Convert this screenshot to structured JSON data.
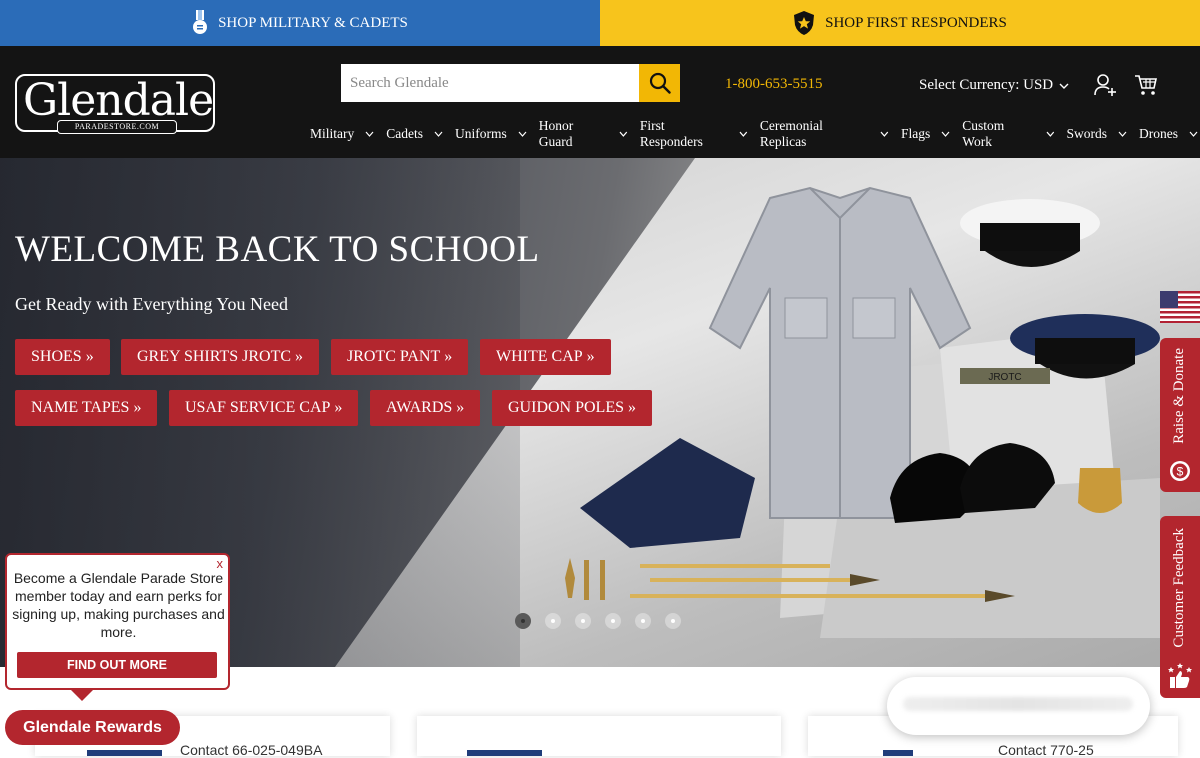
{
  "topbar": {
    "military_label": "SHOP MILITARY & CADETS",
    "military_icon": "medal-icon",
    "responders_label": "SHOP FIRST RESPONDERS",
    "responders_icon": "badge-star-icon"
  },
  "header": {
    "logo_word": "Glendale",
    "logo_sub": "PARADESTORE.COM",
    "search_placeholder": "Search Glendale",
    "phone": "1-800-653-5515",
    "currency_label": "Select Currency: USD"
  },
  "nav": [
    {
      "label": "Military"
    },
    {
      "label": "Cadets"
    },
    {
      "label": "Uniforms"
    },
    {
      "label": "Honor Guard"
    },
    {
      "label": "First Responders"
    },
    {
      "label": "Ceremonial Replicas"
    },
    {
      "label": "Flags"
    },
    {
      "label": "Custom Work"
    },
    {
      "label": "Swords"
    },
    {
      "label": "Drones"
    }
  ],
  "hero": {
    "title": "WELCOME BACK TO SCHOOL",
    "tagline": "Get Ready with Everything You Need",
    "buttons": [
      "SHOES",
      "GREY SHIRTS JROTC",
      "JROTC PANT",
      "WHITE CAP",
      "NAME TAPES",
      "USAF SERVICE CAP",
      "AWARDS",
      "GUIDON POLES"
    ],
    "name_tape_text": "JROTC",
    "slides": 6,
    "active_slide": 1
  },
  "side_tabs": {
    "donate": "Raise & Donate",
    "feedback": "Customer Feedback"
  },
  "popup": {
    "close": "x",
    "message": "Become a Glendale Parade Store member today and earn perks for signing up, making purchases and more.",
    "cta": "FIND OUT MORE"
  },
  "rewards_label": "Glendale Rewards",
  "cards": [
    {
      "text": "Contact 66-025-049BA"
    },
    {
      "text": ""
    },
    {
      "text": "Contact 770-25"
    }
  ],
  "colors": {
    "military_blue": "#2b6cb8",
    "responder_yellow": "#f7c41c",
    "brand_red": "#b3262e",
    "header_black": "#141414",
    "phone_gold": "#f2b705"
  }
}
